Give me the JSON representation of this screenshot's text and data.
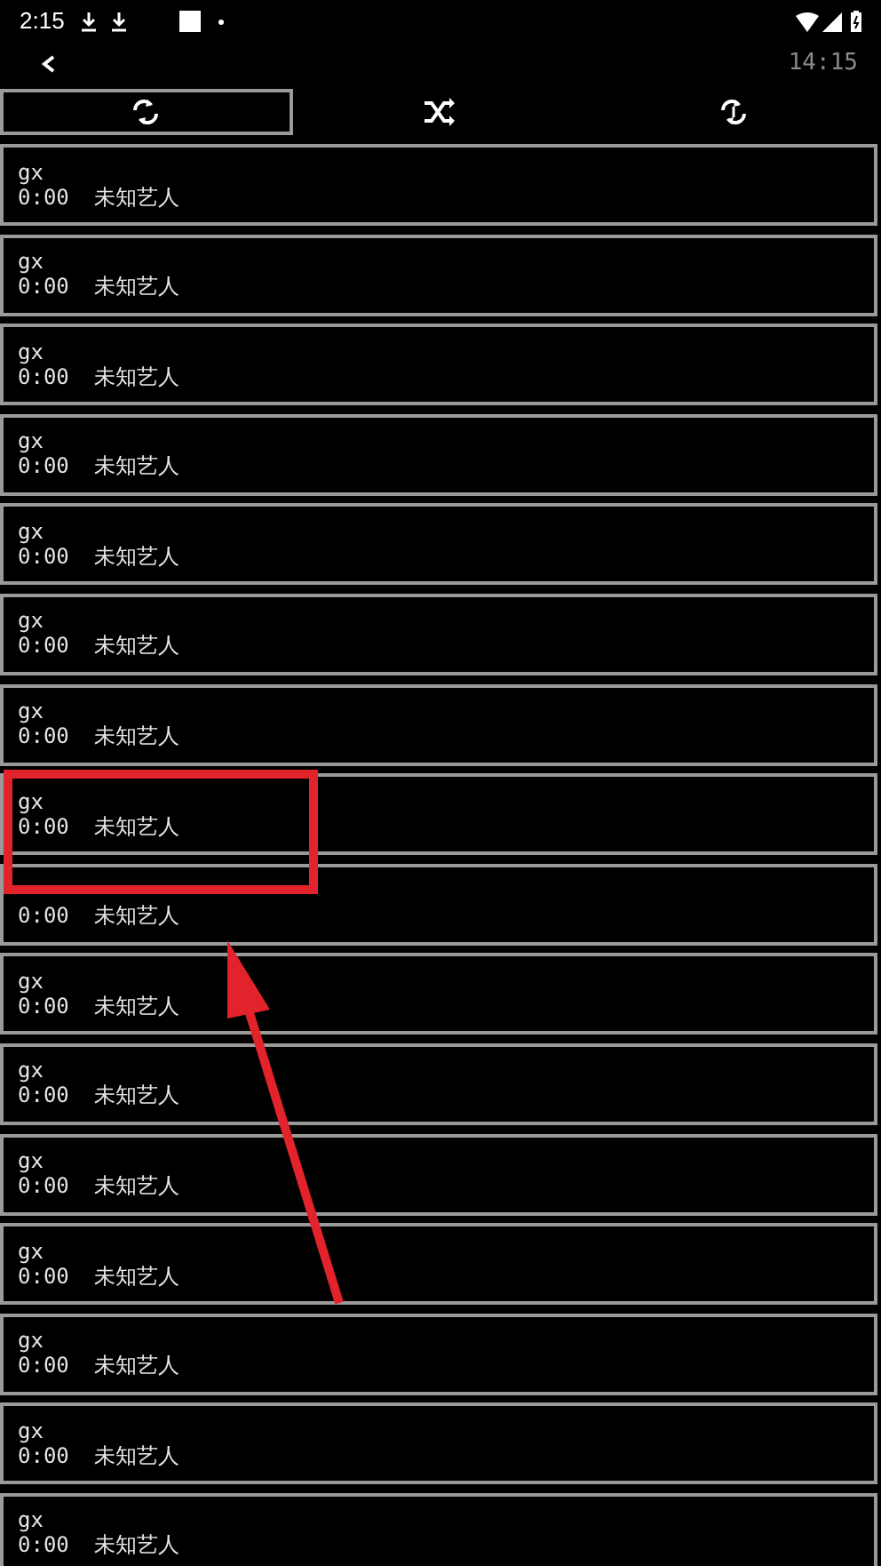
{
  "status_bar": {
    "time": "2:15"
  },
  "header": {
    "time": "14:15"
  },
  "modes": [
    {
      "kind": "repeat",
      "selected": true
    },
    {
      "kind": "shuffle",
      "selected": false
    },
    {
      "kind": "repeat_one",
      "selected": false
    }
  ],
  "tracks": [
    {
      "title": "gx",
      "duration": "0:00",
      "artist": "未知艺人"
    },
    {
      "title": "gx",
      "duration": "0:00",
      "artist": "未知艺人"
    },
    {
      "title": "gx",
      "duration": "0:00",
      "artist": "未知艺人"
    },
    {
      "title": "gx",
      "duration": "0:00",
      "artist": "未知艺人"
    },
    {
      "title": "gx",
      "duration": "0:00",
      "artist": "未知艺人"
    },
    {
      "title": "gx",
      "duration": "0:00",
      "artist": "未知艺人"
    },
    {
      "title": "gx",
      "duration": "0:00",
      "artist": "未知艺人"
    },
    {
      "title": "gx",
      "duration": "0:00",
      "artist": "未知艺人"
    },
    {
      "duration": "0:00",
      "artist": "未知艺人"
    },
    {
      "title": "gx",
      "duration": "0:00",
      "artist": "未知艺人"
    },
    {
      "title": "gx",
      "duration": "0:00",
      "artist": "未知艺人"
    },
    {
      "title": "gx",
      "duration": "0:00",
      "artist": "未知艺人"
    },
    {
      "title": "gx",
      "duration": "0:00",
      "artist": "未知艺人"
    },
    {
      "title": "gx",
      "duration": "0:00",
      "artist": "未知艺人"
    },
    {
      "title": "gx",
      "duration": "0:00",
      "artist": "未知艺人"
    },
    {
      "title": "gx",
      "duration": "0:00",
      "artist": "未知艺人"
    }
  ]
}
